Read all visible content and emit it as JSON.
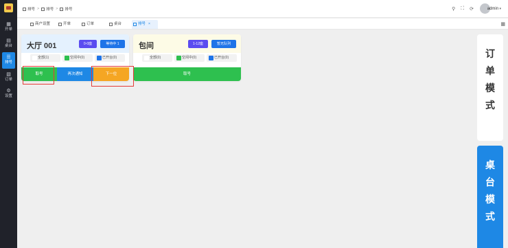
{
  "sidebar": {
    "items": [
      {
        "label": "开单",
        "icon": "table-icon"
      },
      {
        "label": "桌台",
        "icon": "desk-icon"
      },
      {
        "label": "排号",
        "icon": "list-icon",
        "active": true
      },
      {
        "label": "订单",
        "icon": "document-icon"
      },
      {
        "label": "设置",
        "icon": "gear-icon"
      }
    ]
  },
  "header": {
    "breadcrumb": [
      "排号",
      "排号",
      "排号"
    ],
    "username": "admin"
  },
  "tabs": [
    {
      "label": "商户设置"
    },
    {
      "label": "开单"
    },
    {
      "label": "订单"
    },
    {
      "label": "桌台"
    },
    {
      "label": "排号",
      "active": true,
      "close": "×"
    }
  ],
  "cards": [
    {
      "title": "大厅 001",
      "range_btn": "0-0座",
      "status_btn": "等待中 1",
      "filters": [
        {
          "label": "全部(1)",
          "color": "#ffffff"
        },
        {
          "label": "空闲中(0)",
          "color": "#2ec04f"
        },
        {
          "label": "已开台(0)",
          "color": "#1e74e8"
        }
      ],
      "actions": [
        "取号",
        "再次通知",
        "下一位"
      ]
    },
    {
      "title": "包间",
      "range_btn": "1-12座",
      "status_btn": "暂无队列",
      "filters": [
        {
          "label": "全部(0)",
          "color": "#ffffff"
        },
        {
          "label": "空闲中(0)",
          "color": "#2ec04f"
        },
        {
          "label": "已开台(0)",
          "color": "#1e74e8"
        }
      ],
      "actions": [
        "取号"
      ]
    }
  ],
  "modes": {
    "order_mode": [
      "订",
      "单",
      "模",
      "式"
    ],
    "table_mode": [
      "桌",
      "台",
      "模",
      "式"
    ]
  },
  "colors": {
    "green": "#2ec04f",
    "blue": "#1e88e5",
    "orange": "#f5a623",
    "purple": "#5b4cf0",
    "sidebar_bg": "#20222a"
  }
}
